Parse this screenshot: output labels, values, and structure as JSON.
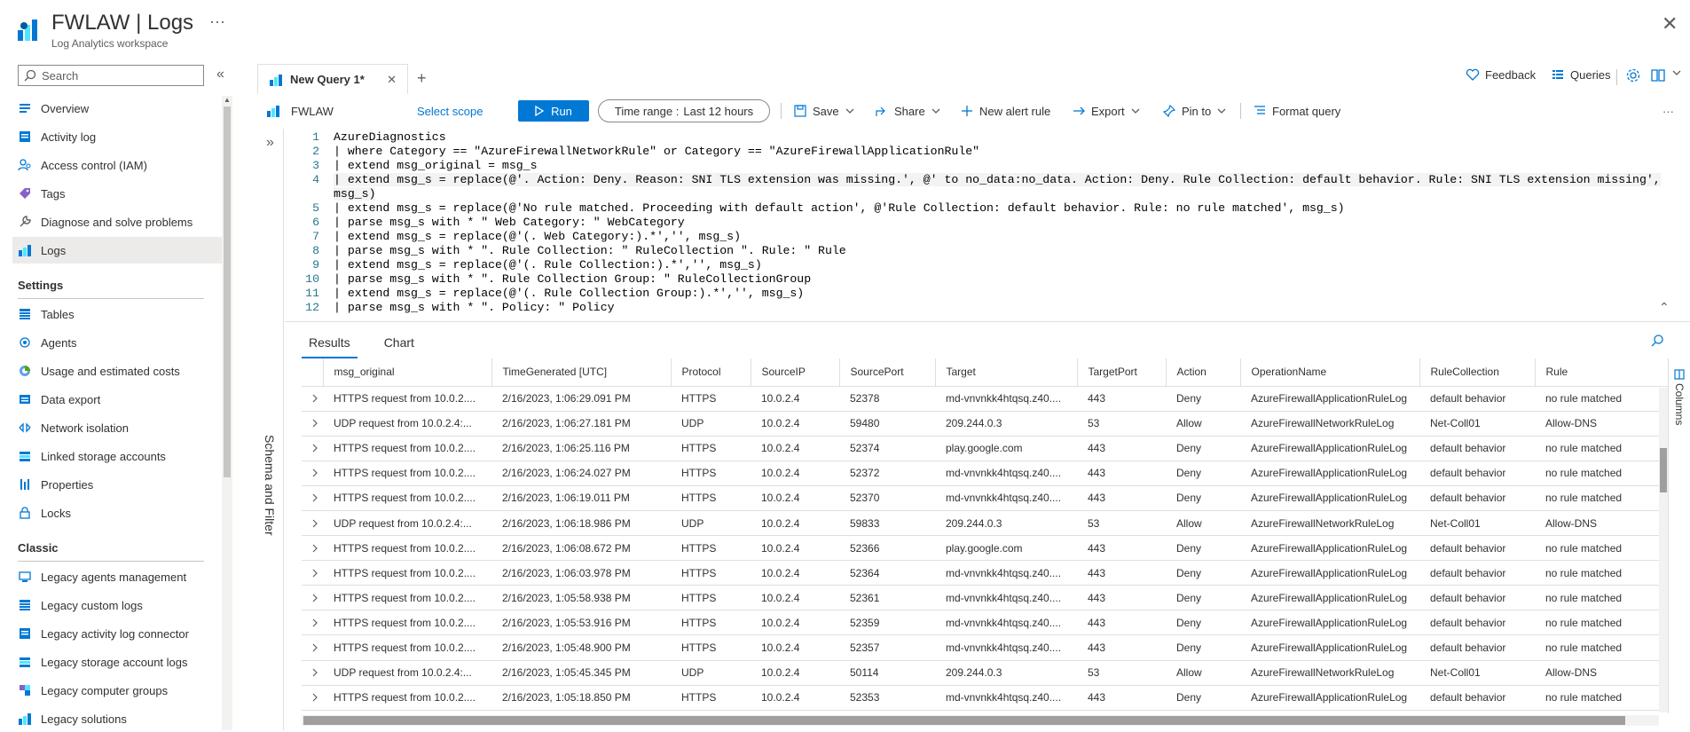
{
  "header": {
    "title": "FWLAW | Logs",
    "subtitle": "Log Analytics workspace",
    "more": "···",
    "close": "✕"
  },
  "sidebar": {
    "search_placeholder": "Search",
    "collapse": "«",
    "items": [
      {
        "label": "Overview",
        "icon": "overview-icon"
      },
      {
        "label": "Activity log",
        "icon": "activity-log-icon"
      },
      {
        "label": "Access control (IAM)",
        "icon": "iam-icon"
      },
      {
        "label": "Tags",
        "icon": "tag-icon"
      },
      {
        "label": "Diagnose and solve problems",
        "icon": "wrench-icon"
      },
      {
        "label": "Logs",
        "icon": "logs-icon",
        "active": true
      }
    ],
    "settings_title": "Settings",
    "settings": [
      {
        "label": "Tables",
        "icon": "table-icon"
      },
      {
        "label": "Agents",
        "icon": "agents-icon"
      },
      {
        "label": "Usage and estimated costs",
        "icon": "usage-icon"
      },
      {
        "label": "Data export",
        "icon": "export-icon"
      },
      {
        "label": "Network isolation",
        "icon": "network-icon"
      },
      {
        "label": "Linked storage accounts",
        "icon": "storage-icon"
      },
      {
        "label": "Properties",
        "icon": "properties-icon"
      },
      {
        "label": "Locks",
        "icon": "lock-icon"
      }
    ],
    "classic_title": "Classic",
    "classic": [
      {
        "label": "Legacy agents management",
        "icon": "legacy-agents-icon"
      },
      {
        "label": "Legacy custom logs",
        "icon": "custom-logs-icon"
      },
      {
        "label": "Legacy activity log connector",
        "icon": "activity-connector-icon"
      },
      {
        "label": "Legacy storage account logs",
        "icon": "storage-logs-icon"
      },
      {
        "label": "Legacy computer groups",
        "icon": "computer-groups-icon"
      },
      {
        "label": "Legacy solutions",
        "icon": "solutions-icon"
      }
    ]
  },
  "query_tab": {
    "label": "New Query 1*",
    "close": "✕",
    "add": "+"
  },
  "top_actions": {
    "feedback": "Feedback",
    "queries": "Queries"
  },
  "toolbar": {
    "scope": "FWLAW",
    "select_scope": "Select scope",
    "run": "Run",
    "time_range_label": "Time range :",
    "time_range_value": "Last 12 hours",
    "save": "Save",
    "share": "Share",
    "new_alert": "New alert rule",
    "export": "Export",
    "pin": "Pin to",
    "format": "Format query",
    "more": "···"
  },
  "editor": {
    "lines": [
      {
        "n": "1",
        "code": "AzureDiagnostics"
      },
      {
        "n": "2",
        "code": "| where Category == \"AzureFirewallNetworkRule\" or Category == \"AzureFirewallApplicationRule\""
      },
      {
        "n": "3",
        "code": "| extend msg_original = msg_s"
      },
      {
        "n": "4",
        "code": "| extend msg_s = replace(@'. Action: Deny. Reason: SNI TLS extension was missing.', @' to no_data:no_data. Action: Deny. Rule Collection: default behavior. Rule: SNI TLS extension missing',"
      },
      {
        "n": "",
        "code": "msg_s)"
      },
      {
        "n": "5",
        "code": "| extend msg_s = replace(@'No rule matched. Proceeding with default action', @'Rule Collection: default behavior. Rule: no rule matched', msg_s)"
      },
      {
        "n": "6",
        "code": "| parse msg_s with * \" Web Category: \" WebCategory"
      },
      {
        "n": "7",
        "code": "| extend msg_s = replace(@'(. Web Category:).*','', msg_s)"
      },
      {
        "n": "8",
        "code": "| parse msg_s with * \". Rule Collection: \" RuleCollection \". Rule: \" Rule"
      },
      {
        "n": "9",
        "code": "| extend msg_s = replace(@'(. Rule Collection:).*','', msg_s)"
      },
      {
        "n": "10",
        "code": "| parse msg_s with * \". Rule Collection Group: \" RuleCollectionGroup"
      },
      {
        "n": "11",
        "code": "| extend msg_s = replace(@'(. Rule Collection Group:).*','', msg_s)"
      },
      {
        "n": "12",
        "code": "| parse msg_s with * \". Policy: \" Policy"
      }
    ]
  },
  "schema_label": "Schema and Filter",
  "results_tabs": [
    "Results",
    "Chart"
  ],
  "columns_label": "Columns",
  "grid": {
    "headers": [
      "msg_original",
      "TimeGenerated [UTC]",
      "Protocol",
      "SourceIP",
      "SourcePort",
      "Target",
      "TargetPort",
      "Action",
      "OperationName",
      "RuleCollection",
      "Rule"
    ],
    "rows": [
      [
        "HTTPS request from 10.0.2....",
        "2/16/2023, 1:06:29.091 PM",
        "HTTPS",
        "10.0.2.4",
        "52378",
        "md-vnvnkk4htqsq.z40....",
        "443",
        "Deny",
        "AzureFirewallApplicationRuleLog",
        "default behavior",
        "no rule matched"
      ],
      [
        "UDP request from 10.0.2.4:...",
        "2/16/2023, 1:06:27.181 PM",
        "UDP",
        "10.0.2.4",
        "59480",
        "209.244.0.3",
        "53",
        "Allow",
        "AzureFirewallNetworkRuleLog",
        "Net-Coll01",
        "Allow-DNS"
      ],
      [
        "HTTPS request from 10.0.2....",
        "2/16/2023, 1:06:25.116 PM",
        "HTTPS",
        "10.0.2.4",
        "52374",
        "play.google.com",
        "443",
        "Deny",
        "AzureFirewallApplicationRuleLog",
        "default behavior",
        "no rule matched"
      ],
      [
        "HTTPS request from 10.0.2....",
        "2/16/2023, 1:06:24.027 PM",
        "HTTPS",
        "10.0.2.4",
        "52372",
        "md-vnvnkk4htqsq.z40....",
        "443",
        "Deny",
        "AzureFirewallApplicationRuleLog",
        "default behavior",
        "no rule matched"
      ],
      [
        "HTTPS request from 10.0.2....",
        "2/16/2023, 1:06:19.011 PM",
        "HTTPS",
        "10.0.2.4",
        "52370",
        "md-vnvnkk4htqsq.z40....",
        "443",
        "Deny",
        "AzureFirewallApplicationRuleLog",
        "default behavior",
        "no rule matched"
      ],
      [
        "UDP request from 10.0.2.4:...",
        "2/16/2023, 1:06:18.986 PM",
        "UDP",
        "10.0.2.4",
        "59833",
        "209.244.0.3",
        "53",
        "Allow",
        "AzureFirewallNetworkRuleLog",
        "Net-Coll01",
        "Allow-DNS"
      ],
      [
        "HTTPS request from 10.0.2....",
        "2/16/2023, 1:06:08.672 PM",
        "HTTPS",
        "10.0.2.4",
        "52366",
        "play.google.com",
        "443",
        "Deny",
        "AzureFirewallApplicationRuleLog",
        "default behavior",
        "no rule matched"
      ],
      [
        "HTTPS request from 10.0.2....",
        "2/16/2023, 1:06:03.978 PM",
        "HTTPS",
        "10.0.2.4",
        "52364",
        "md-vnvnkk4htqsq.z40....",
        "443",
        "Deny",
        "AzureFirewallApplicationRuleLog",
        "default behavior",
        "no rule matched"
      ],
      [
        "HTTPS request from 10.0.2....",
        "2/16/2023, 1:05:58.938 PM",
        "HTTPS",
        "10.0.2.4",
        "52361",
        "md-vnvnkk4htqsq.z40....",
        "443",
        "Deny",
        "AzureFirewallApplicationRuleLog",
        "default behavior",
        "no rule matched"
      ],
      [
        "HTTPS request from 10.0.2....",
        "2/16/2023, 1:05:53.916 PM",
        "HTTPS",
        "10.0.2.4",
        "52359",
        "md-vnvnkk4htqsq.z40....",
        "443",
        "Deny",
        "AzureFirewallApplicationRuleLog",
        "default behavior",
        "no rule matched"
      ],
      [
        "HTTPS request from 10.0.2....",
        "2/16/2023, 1:05:48.900 PM",
        "HTTPS",
        "10.0.2.4",
        "52357",
        "md-vnvnkk4htqsq.z40....",
        "443",
        "Deny",
        "AzureFirewallApplicationRuleLog",
        "default behavior",
        "no rule matched"
      ],
      [
        "UDP request from 10.0.2.4:...",
        "2/16/2023, 1:05:45.345 PM",
        "UDP",
        "10.0.2.4",
        "50114",
        "209.244.0.3",
        "53",
        "Allow",
        "AzureFirewallNetworkRuleLog",
        "Net-Coll01",
        "Allow-DNS"
      ],
      [
        "HTTPS request from 10.0.2....",
        "2/16/2023, 1:05:18.850 PM",
        "HTTPS",
        "10.0.2.4",
        "52353",
        "md-vnvnkk4htqsq.z40....",
        "443",
        "Deny",
        "AzureFirewallApplicationRuleLog",
        "default behavior",
        "no rule matched"
      ]
    ]
  },
  "colors": {
    "accent": "#0078d4",
    "code_keyword": "#0000ff",
    "code_string": "#a31515",
    "line_number": "#237893"
  }
}
